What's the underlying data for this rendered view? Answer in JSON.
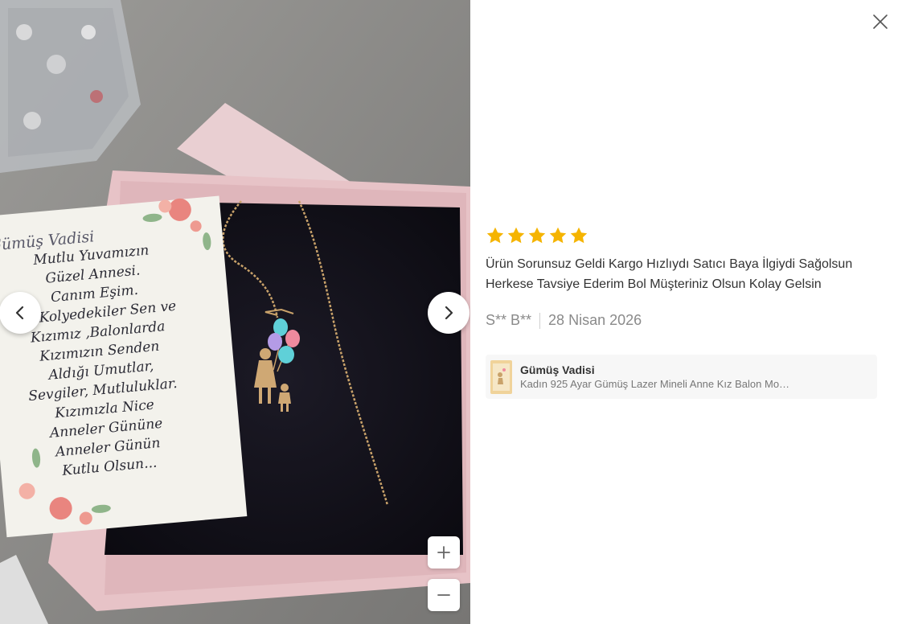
{
  "photo": {
    "card_lines": [
      "Gümüş Vadisi",
      "Mutlu Yuvamızın",
      "Güzel Annesi.",
      "Canım Eşim.",
      "Bu Kolyedekiler Sen ve",
      "Kızımız ,Balonlarda",
      "Kızımızın Senden",
      "Aldığı Umutlar,",
      "Sevgiler, Mutluluklar.",
      "Kızımızla Nice",
      "Anneler Gününe",
      "Anneler Günün",
      "Kutlu Olsun..."
    ]
  },
  "viewer": {
    "prev_icon": "chevron-left-icon",
    "next_icon": "chevron-right-icon",
    "zoom_in_label": "+",
    "zoom_out_label": "−"
  },
  "review": {
    "rating": 5,
    "max_rating": 5,
    "star_color": "#f5b400",
    "text": "Ürün Sorunsuz Geldi Kargo Hızlıydı Satıcı Baya İlgiydi Sağolsun Herkese Tavsiye Ederim Bol Müşteriniz Olsun Kolay Gelsin",
    "author": "S** B**",
    "date": "28 Nisan 2026"
  },
  "product": {
    "store": "Gümüş Vadisi",
    "name": "Kadın 925 Ayar Gümüş Lazer Mineli Anne Kız Balon Mo…"
  },
  "close_icon": "close-icon"
}
